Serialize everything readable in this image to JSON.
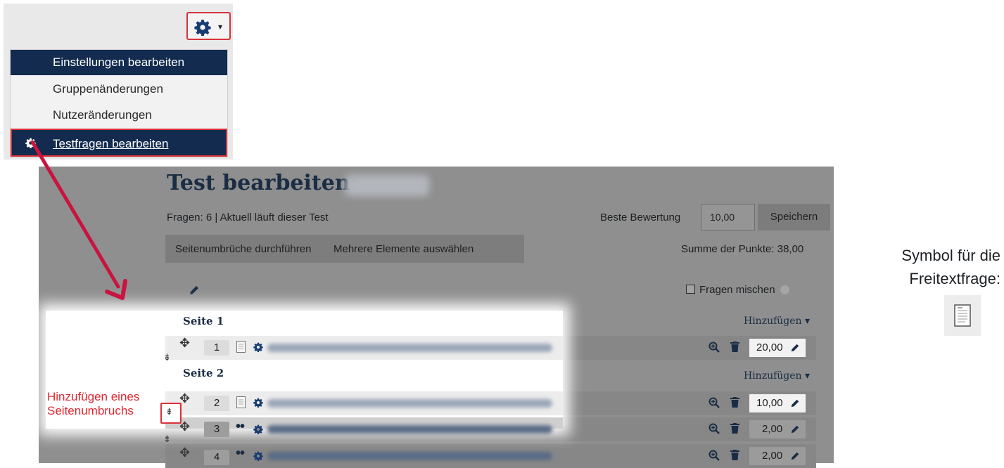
{
  "menu": {
    "items": [
      {
        "label": "Einstellungen bearbeiten",
        "active": true
      },
      {
        "label": "Gruppenänderungen",
        "active": false
      },
      {
        "label": "Nutzeränderungen",
        "active": false
      },
      {
        "label": "Testfragen bearbeiten",
        "active": true,
        "icon": "gear-icon",
        "highlighted": true
      }
    ],
    "settings_icon": "gear-icon",
    "highlight_color": "#d9323a"
  },
  "quiz": {
    "title": "Test bearbeiten:",
    "info": "Fragen: 6 | Aktuell läuft dieser Test",
    "max_grade_label": "Beste Bewertung",
    "max_grade_value": "10,00",
    "save_label": "Speichern",
    "repaginate_label": "Seitenumbrüche durchführen",
    "select_multiple_label": "Mehrere Elemente auswählen",
    "total_marks": "Summe der Punkte: 38,00",
    "shuffle_label": "Fragen mischen",
    "pages": [
      {
        "label": "Seite 1",
        "add_label": "Hinzufügen"
      },
      {
        "label": "Seite 2",
        "add_label": "Hinzufügen"
      }
    ],
    "questions": [
      {
        "slot": "1",
        "type_icon": "essay-icon",
        "mark": "20,00"
      },
      {
        "slot": "2",
        "type_icon": "essay-icon",
        "mark": "10,00"
      },
      {
        "slot": "3",
        "type_icon": "dots-icon",
        "mark": "2,00"
      },
      {
        "slot": "4",
        "type_icon": "dots-icon",
        "mark": "2,00"
      }
    ]
  },
  "annotation": {
    "line1": "Hinzufügen eines",
    "line2": "Seitenumbruchs",
    "color": "#e0262e"
  },
  "side_note": {
    "line1": "Symbol für die",
    "line2": "Freitextfrage:",
    "icon": "essay-icon"
  },
  "arrow_color": "#c8143f"
}
